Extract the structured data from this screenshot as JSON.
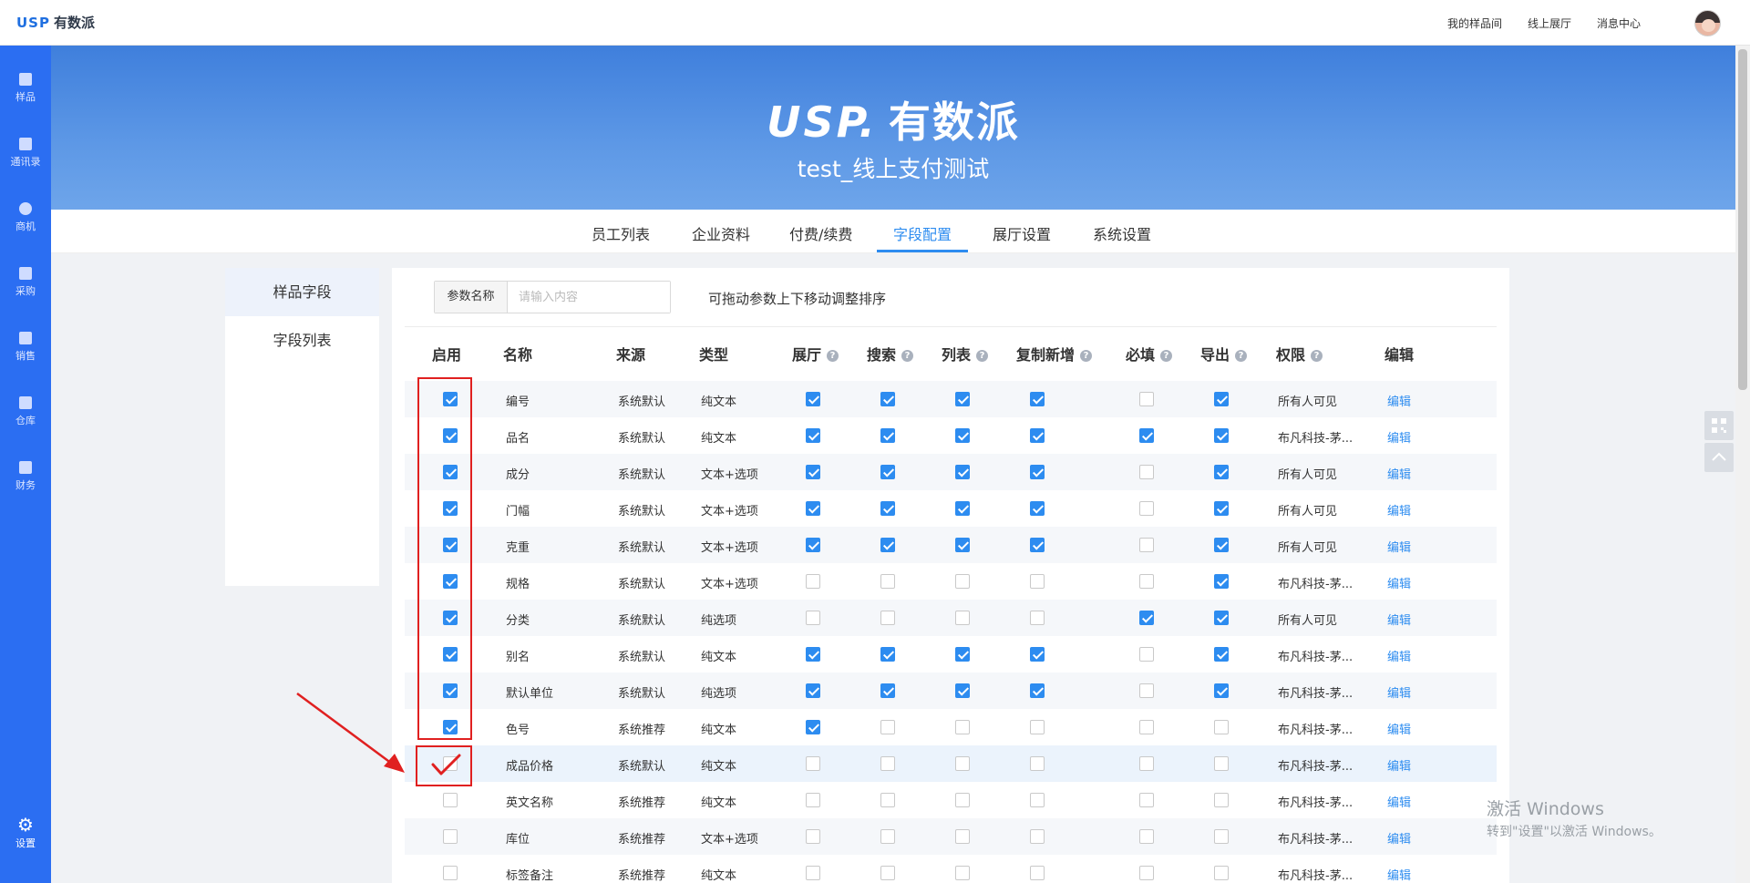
{
  "app": {
    "logo_usp": "USP",
    "logo_name": "有数派",
    "top_links": [
      "我的样品间",
      "线上展厅",
      "消息中心"
    ]
  },
  "sidebar": {
    "items": [
      "样品",
      "通讯录",
      "商机",
      "采购",
      "销售",
      "仓库",
      "财务"
    ],
    "settings": "设置"
  },
  "banner": {
    "logo_usp": "USP.",
    "logo_name": "有数派",
    "company": "test_线上支付测试"
  },
  "tabs": [
    "员工列表",
    "企业资料",
    "付费/续费",
    "字段配置",
    "展厅设置",
    "系统设置"
  ],
  "active_tab": "字段配置",
  "left_menu": [
    "样品字段",
    "字段列表"
  ],
  "search": {
    "label": "参数名称",
    "placeholder": "请输入内容",
    "hint": "可拖动参数上下移动调整排序"
  },
  "table": {
    "headers": [
      "启用",
      "名称",
      "来源",
      "类型",
      "展厅",
      "搜索",
      "列表",
      "复制新增",
      "必填",
      "导出",
      "权限",
      "编辑"
    ],
    "edit_label": "编辑",
    "rows": [
      {
        "enabled": true,
        "name": "编号",
        "source": "系统默认",
        "type": "纯文本",
        "hall": true,
        "search": true,
        "list": true,
        "copy": true,
        "required": false,
        "export": true,
        "perm": "所有人可见"
      },
      {
        "enabled": true,
        "name": "品名",
        "source": "系统默认",
        "type": "纯文本",
        "hall": true,
        "search": true,
        "list": true,
        "copy": true,
        "required": true,
        "export": true,
        "perm": "布凡科技-茅..."
      },
      {
        "enabled": true,
        "name": "成分",
        "source": "系统默认",
        "type": "文本+选项",
        "hall": true,
        "search": true,
        "list": true,
        "copy": true,
        "required": false,
        "export": true,
        "perm": "所有人可见"
      },
      {
        "enabled": true,
        "name": "门幅",
        "source": "系统默认",
        "type": "文本+选项",
        "hall": true,
        "search": true,
        "list": true,
        "copy": true,
        "required": false,
        "export": true,
        "perm": "所有人可见"
      },
      {
        "enabled": true,
        "name": "克重",
        "source": "系统默认",
        "type": "文本+选项",
        "hall": true,
        "search": true,
        "list": true,
        "copy": true,
        "required": false,
        "export": true,
        "perm": "所有人可见"
      },
      {
        "enabled": true,
        "name": "规格",
        "source": "系统默认",
        "type": "文本+选项",
        "hall": false,
        "search": false,
        "list": false,
        "copy": false,
        "required": false,
        "export": true,
        "perm": "布凡科技-茅..."
      },
      {
        "enabled": true,
        "name": "分类",
        "source": "系统默认",
        "type": "纯选项",
        "hall": false,
        "search": false,
        "list": false,
        "copy": false,
        "required": true,
        "export": true,
        "perm": "所有人可见"
      },
      {
        "enabled": true,
        "name": "别名",
        "source": "系统默认",
        "type": "纯文本",
        "hall": true,
        "search": true,
        "list": true,
        "copy": true,
        "required": false,
        "export": true,
        "perm": "布凡科技-茅..."
      },
      {
        "enabled": true,
        "name": "默认单位",
        "source": "系统默认",
        "type": "纯选项",
        "hall": true,
        "search": true,
        "list": true,
        "copy": true,
        "required": false,
        "export": true,
        "perm": "布凡科技-茅..."
      },
      {
        "enabled": true,
        "name": "色号",
        "source": "系统推荐",
        "type": "纯文本",
        "hall": true,
        "search": false,
        "list": false,
        "copy": false,
        "required": false,
        "export": false,
        "perm": "布凡科技-茅..."
      },
      {
        "enabled": false,
        "name": "成品价格",
        "source": "系统默认",
        "type": "纯文本",
        "hall": false,
        "search": false,
        "list": false,
        "copy": false,
        "required": false,
        "export": false,
        "perm": "布凡科技-茅..."
      },
      {
        "enabled": false,
        "name": "英文名称",
        "source": "系统推荐",
        "type": "纯文本",
        "hall": false,
        "search": false,
        "list": false,
        "copy": false,
        "required": false,
        "export": false,
        "perm": "布凡科技-茅..."
      },
      {
        "enabled": false,
        "name": "库位",
        "source": "系统推荐",
        "type": "文本+选项",
        "hall": false,
        "search": false,
        "list": false,
        "copy": false,
        "required": false,
        "export": false,
        "perm": "布凡科技-茅..."
      },
      {
        "enabled": false,
        "name": "标签备注",
        "source": "系统推荐",
        "type": "纯文本",
        "hall": false,
        "search": false,
        "list": false,
        "copy": false,
        "required": false,
        "export": false,
        "perm": "布凡科技-茅..."
      }
    ]
  },
  "watermark": {
    "line1": "激活 Windows",
    "line2": "转到\"设置\"以激活 Windows。"
  },
  "colors": {
    "primary": "#2d8cf0",
    "sidebar": "#2b6ef2",
    "annotation": "#e02020"
  }
}
